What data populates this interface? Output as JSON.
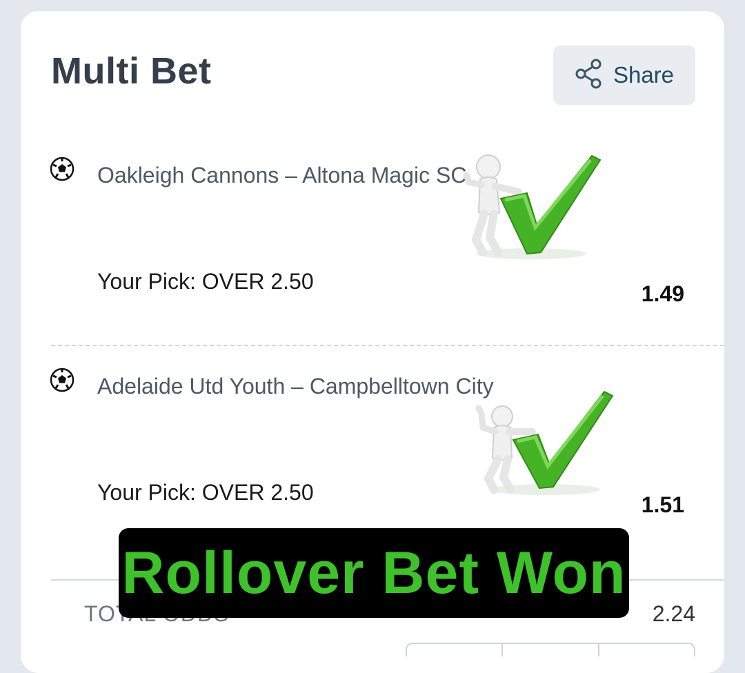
{
  "header": {
    "title": "Multi Bet",
    "share_label": "Share"
  },
  "selections": [
    {
      "match": "Oakleigh Cannons – Altona Magic SC",
      "pick": "Your Pick: OVER 2.50",
      "odds": "1.49",
      "status_icon": "won-checkmark-icon"
    },
    {
      "match": "Adelaide Utd Youth – Campbelltown City",
      "pick": "Your Pick: OVER 2.50",
      "odds": "1.51",
      "status_icon": "won-checkmark-icon"
    }
  ],
  "summary": {
    "total_odds_label": "TOTAL ODDS",
    "total_odds_value": "2.24"
  },
  "overlay": {
    "banner_text": "Rollover Bet Won"
  },
  "colors": {
    "accent_green": "#3ec12a",
    "title": "#343f4b",
    "share_bg": "#e9edf2"
  }
}
